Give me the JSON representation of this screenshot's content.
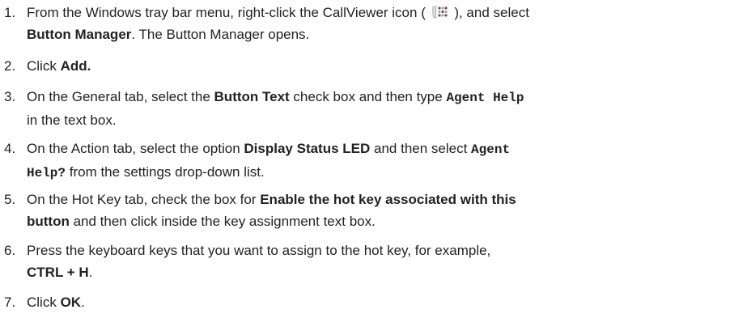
{
  "icons": {
    "callviewer": "callviewer-icon"
  },
  "steps": [
    {
      "num": "1.",
      "a": "From the Windows tray bar menu, right-click the CallViewer icon (",
      "b": "), and select",
      "c": "Button Manager",
      "d": ". The Button Manager opens."
    },
    {
      "num": "2.",
      "a": "Click ",
      "b": "Add."
    },
    {
      "num": "3.",
      "a": "On the General tab, select the ",
      "b": "Button Text",
      "c": " check box and then type ",
      "d": "Agent Help",
      "e": "in the text box."
    },
    {
      "num": "4.",
      "a": "On the Action tab, select the option ",
      "b": "Display Status LED",
      "c": " and then select ",
      "d": "Agent",
      "e": "Help?",
      "f": " from the settings drop-down list."
    },
    {
      "num": "5.",
      "a": "On the Hot Key tab, check the box for ",
      "b": "Enable the hot key associated with this",
      "c": "button",
      "d": " and then click inside the key assignment text box."
    },
    {
      "num": "6.",
      "a": "Press the keyboard keys that you want to assign to the hot key, for example,",
      "b": "CTRL + H",
      "c": "."
    },
    {
      "num": "7.",
      "a": "Click ",
      "b": "OK",
      "c": "."
    }
  ]
}
